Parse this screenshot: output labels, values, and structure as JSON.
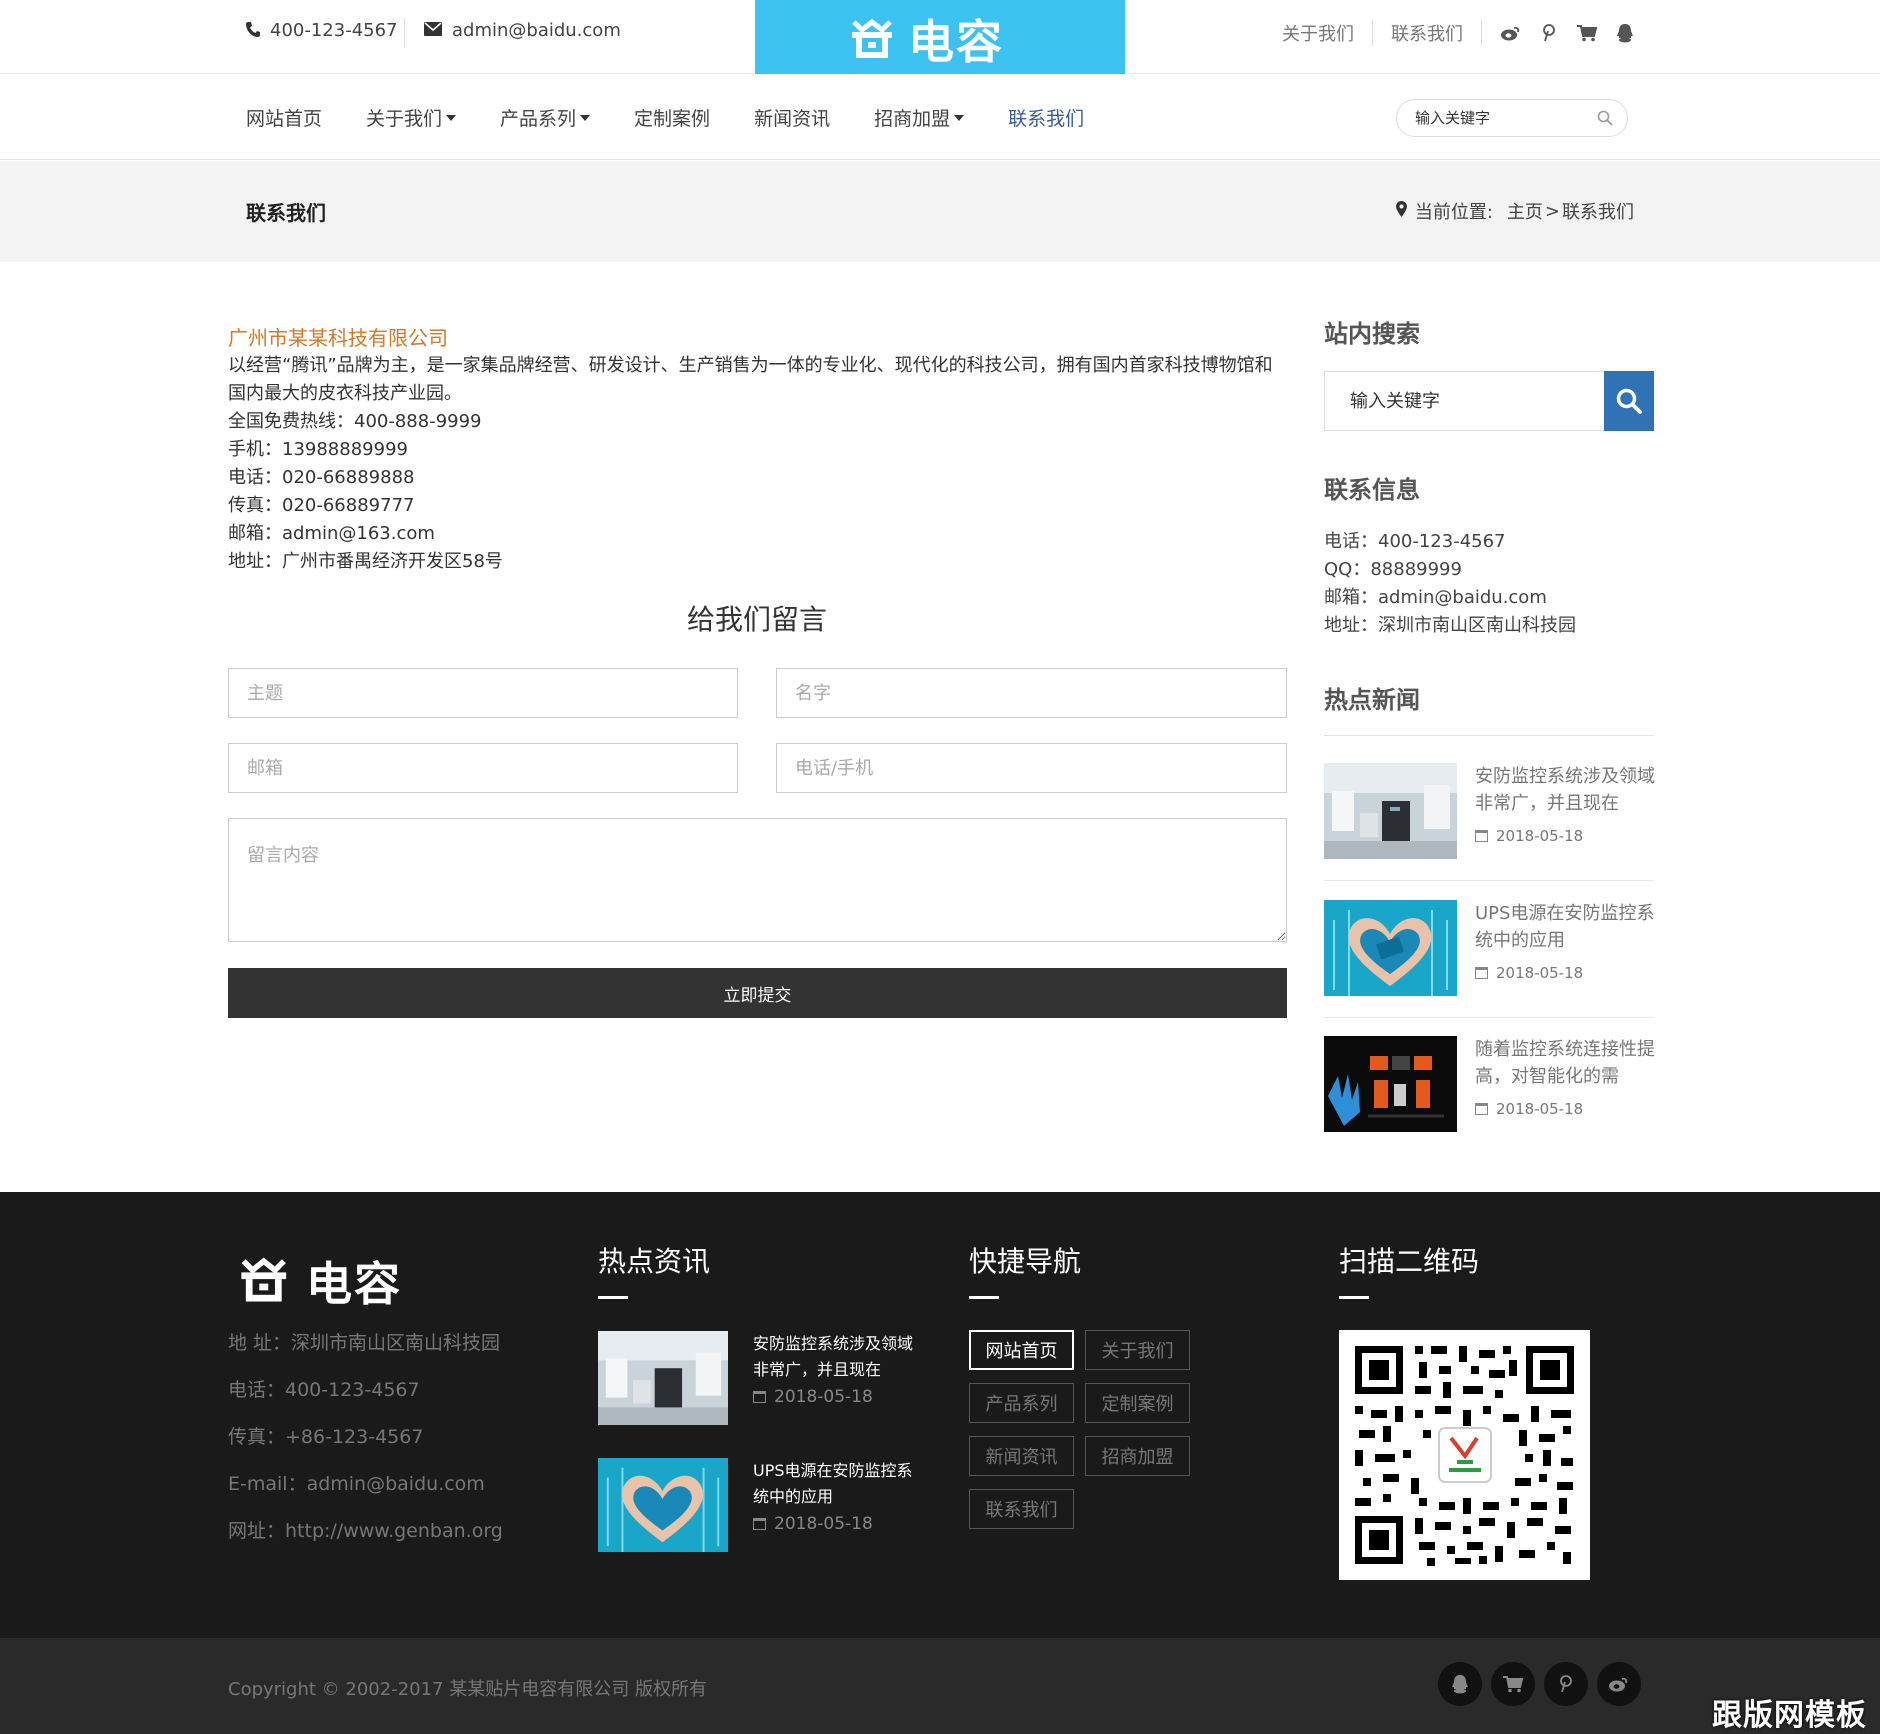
{
  "topbar": {
    "phone": "400-123-4567",
    "email": "admin@baidu.com",
    "logo_text": "电容",
    "links": [
      "关于我们",
      "联系我们"
    ],
    "icons": [
      "weibo-icon",
      "pinterest-icon",
      "cart-icon",
      "qq-icon"
    ]
  },
  "nav": {
    "items": [
      {
        "label": "网站首页",
        "dropdown": false
      },
      {
        "label": "关于我们",
        "dropdown": true
      },
      {
        "label": "产品系列",
        "dropdown": true
      },
      {
        "label": "定制案例",
        "dropdown": false
      },
      {
        "label": "新闻资讯",
        "dropdown": false
      },
      {
        "label": "招商加盟",
        "dropdown": true
      },
      {
        "label": "联系我们",
        "dropdown": false,
        "active": true
      }
    ],
    "search_placeholder": "输入关键字"
  },
  "banner": {
    "title": "联系我们",
    "crumb_label": "当前位置:",
    "crumb_home": "主页",
    "crumb_sep": ">",
    "crumb_current": "联系我们"
  },
  "company": {
    "name": "广州市某某科技有限公司",
    "intro": "以经营“腾讯”品牌为主，是一家集品牌经营、研发设计、生产销售为一体的专业化、现代化的科技公司，拥有国内首家科技博物馆和国内最大的皮衣科技产业园。",
    "hotline": "全国免费热线：400-888-9999",
    "mobile": "手机：13988889999",
    "tel": "电话：020-66889888",
    "fax": "传真：020-66889777",
    "mail": "邮箱：admin@163.com",
    "address": "地址：广州市番禺经济开发区58号"
  },
  "form": {
    "title": "给我们留言",
    "subject_placeholder": "主题",
    "name_placeholder": "名字",
    "email_placeholder": "邮箱",
    "phone_placeholder": "电话/手机",
    "content_placeholder": "留言内容",
    "submit_label": "立即提交"
  },
  "sidebar": {
    "search_title": "站内搜索",
    "search_placeholder": "输入关键字",
    "contact_title": "联系信息",
    "contact": [
      "电话：400-123-4567",
      "QQ：88889999",
      "邮箱：admin@baidu.com",
      "地址：深圳市南山区南山科技园"
    ],
    "news_title": "热点新闻",
    "news": [
      {
        "title": "安防监控系统涉及领域非常广，并且现在",
        "date": "2018-05-18"
      },
      {
        "title": "UPS电源在安防监控系统中的应用",
        "date": "2018-05-18"
      },
      {
        "title": "随着监控系统连接性提高，对智能化的需",
        "date": "2018-05-18"
      }
    ]
  },
  "footer": {
    "logo_text": "电容",
    "info": [
      "地 址：深圳市南山区南山科技园",
      "电话：400-123-4567",
      "传真：+86-123-4567",
      "E-mail：admin@baidu.com",
      "网址：http://www.genban.org"
    ],
    "news_title": "热点资讯",
    "news": [
      {
        "title": "安防监控系统涉及领域非常广，并且现在",
        "date": "2018-05-18"
      },
      {
        "title": "UPS电源在安防监控系统中的应用",
        "date": "2018-05-18"
      }
    ],
    "nav_title": "快捷导航",
    "nav_tags": [
      "网站首页",
      "关于我们",
      "产品系列",
      "定制案例",
      "新闻资讯",
      "招商加盟",
      "联系我们"
    ],
    "qr_title": "扫描二维码",
    "copyright": "Copyright © 2002-2017 某某贴片电容有限公司 版权所有",
    "watermark": "跟版网模板"
  },
  "colors": {
    "logo_bg": "#3bc2f0",
    "accent_blue": "#2f72b6",
    "company_orange": "#d2792b",
    "nav_active": "#3b5b9a",
    "footer_bg": "#1a1a1a"
  }
}
